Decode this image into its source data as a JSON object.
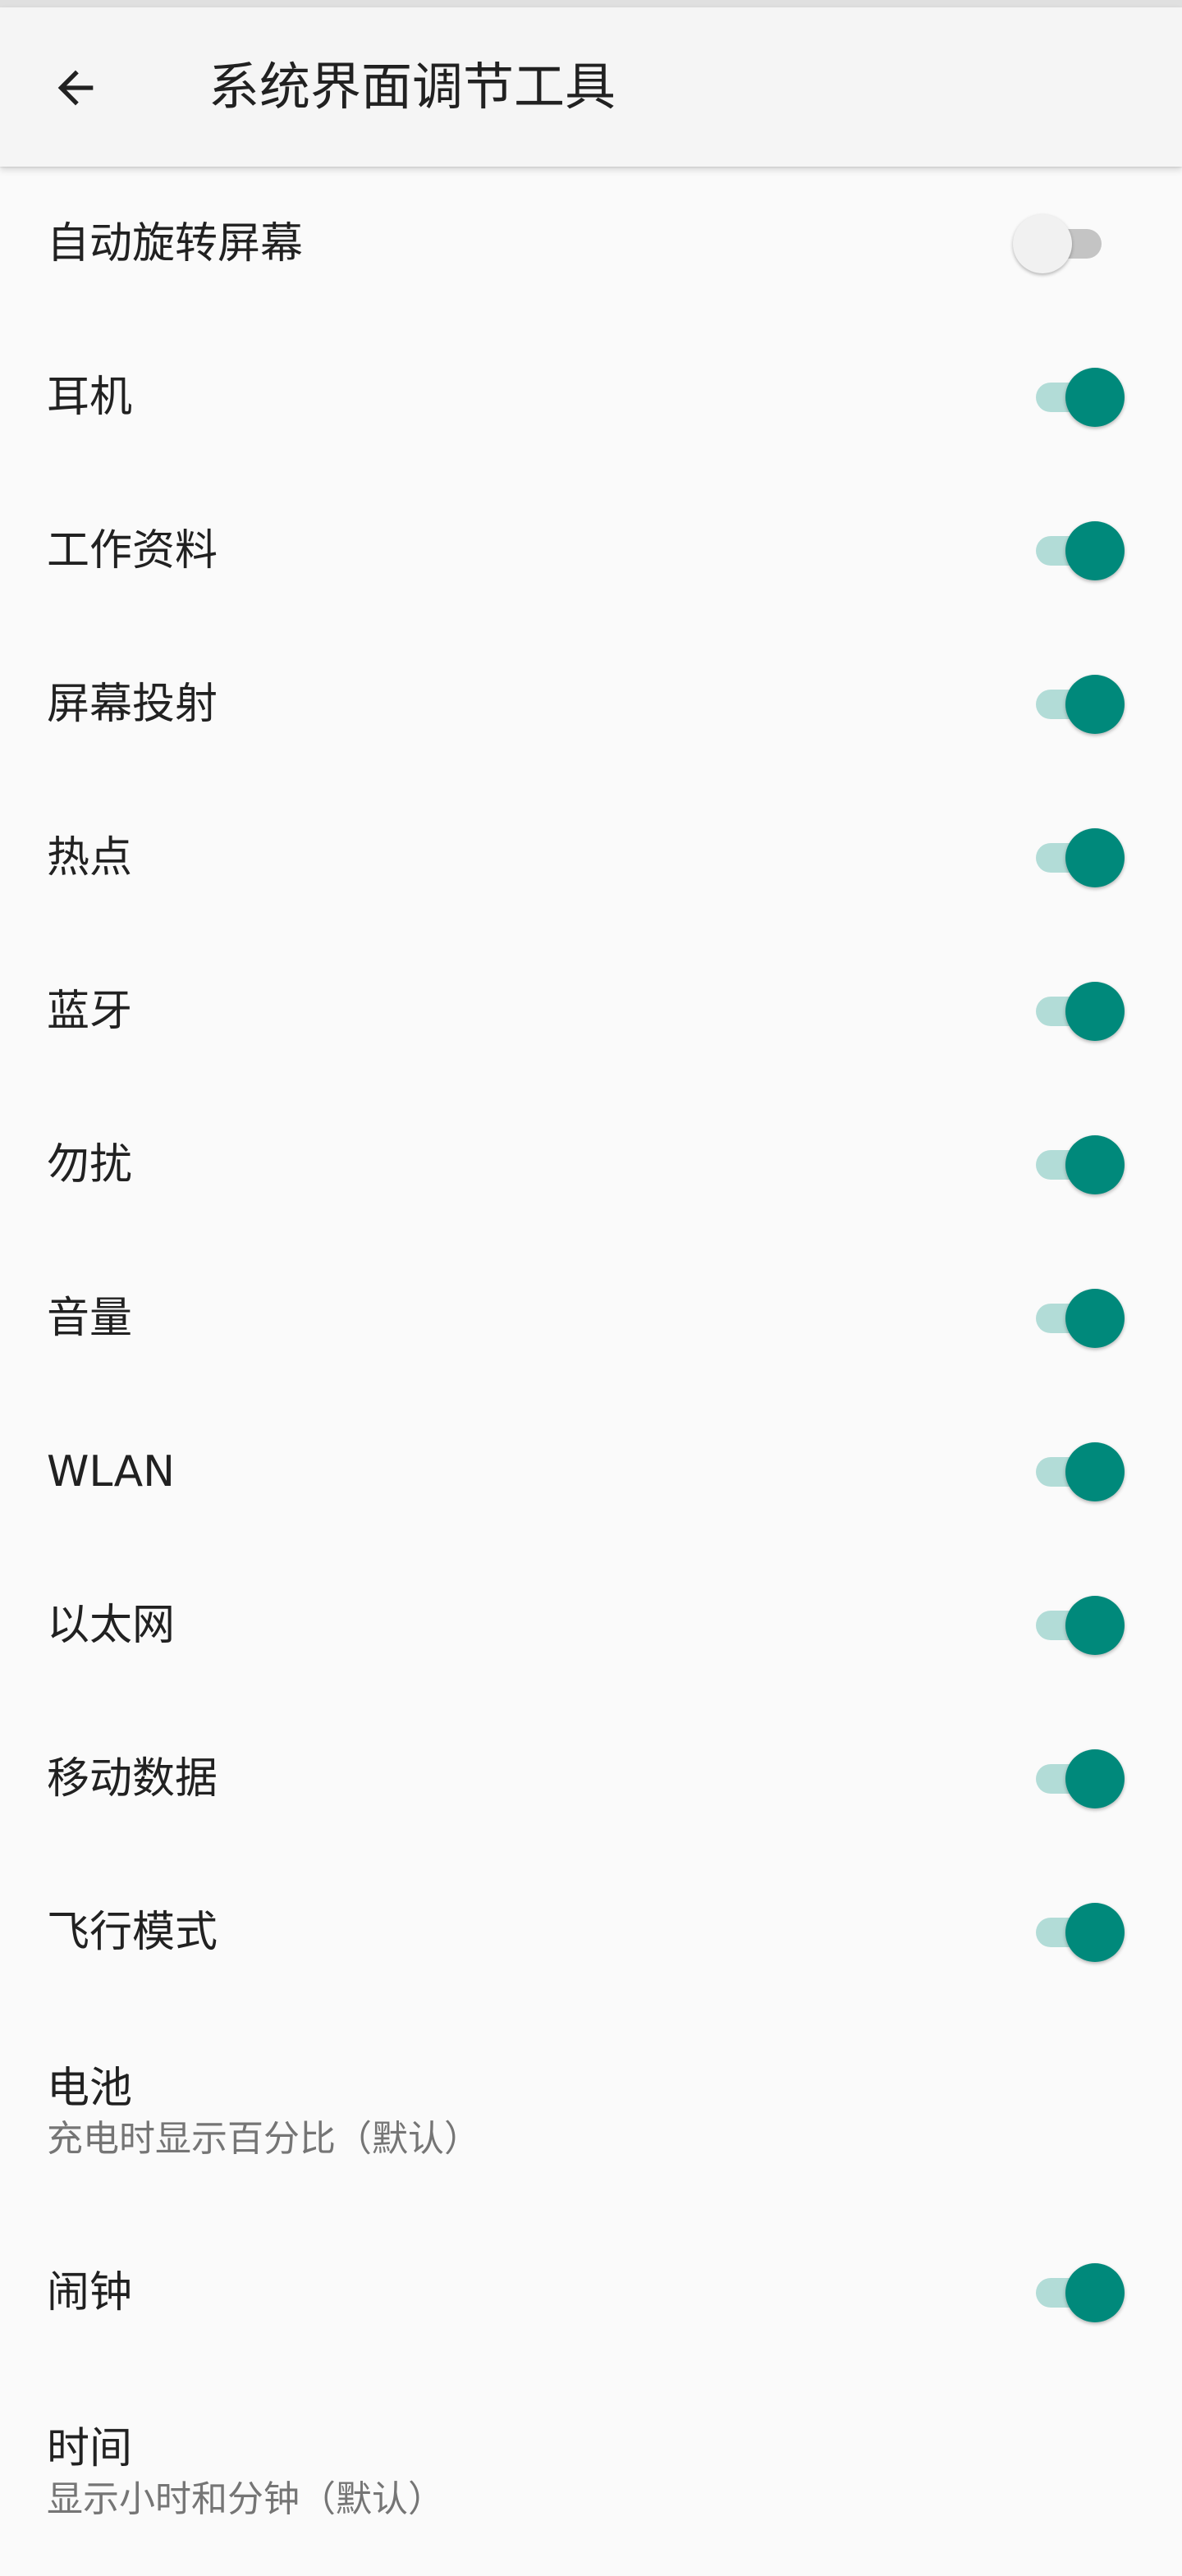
{
  "header": {
    "title": "系统界面调节工具",
    "back_icon": "arrow-back-icon"
  },
  "colors": {
    "accent": "#00897b",
    "track_on": "#b2dcd7",
    "track_off": "#c4c4c4",
    "thumb_off": "#f1f1f1"
  },
  "items": [
    {
      "title": "自动旋转屏幕",
      "toggle": false
    },
    {
      "title": "耳机",
      "toggle": true
    },
    {
      "title": "工作资料",
      "toggle": true
    },
    {
      "title": "屏幕投射",
      "toggle": true
    },
    {
      "title": "热点",
      "toggle": true
    },
    {
      "title": "蓝牙",
      "toggle": true
    },
    {
      "title": "勿扰",
      "toggle": true
    },
    {
      "title": "音量",
      "toggle": true
    },
    {
      "title": "WLAN",
      "toggle": true
    },
    {
      "title": "以太网",
      "toggle": true
    },
    {
      "title": "移动数据",
      "toggle": true
    },
    {
      "title": "飞行模式",
      "toggle": true
    },
    {
      "title": "电池",
      "summary": "充电时显示百分比（默认）"
    },
    {
      "title": "闹钟",
      "toggle": true
    },
    {
      "title": "时间",
      "summary": "显示小时和分钟（默认）"
    }
  ]
}
